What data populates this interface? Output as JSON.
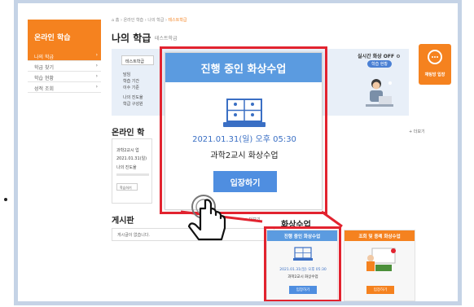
{
  "sidebar": {
    "title": "온라인 학습",
    "items": [
      {
        "label": "나의 학급",
        "active": true
      },
      {
        "label": "학급 찾기",
        "active": false
      },
      {
        "label": "학습 현황",
        "active": false
      },
      {
        "label": "성적 조회",
        "active": false
      }
    ]
  },
  "header": {
    "breadcrumb_home": "⌂ 홈",
    "breadcrumb_parts": [
      "온라인 학습",
      "나의 학급",
      "테스트학급"
    ],
    "title": "나의 학급",
    "subtitle": "테스트학급"
  },
  "info_panel": {
    "select_label": "테스트학급",
    "lines": [
      "담임",
      "학습 기간",
      "이수 기준",
      "나의 진도율",
      "학급 구성원"
    ],
    "realtime_label": "실시간 화상",
    "realtime_state": "OFF",
    "realtime_button": "학습 현황"
  },
  "help_button": {
    "label": "채팅방 입장",
    "icon": "chat-bubble-icon"
  },
  "online_learning": {
    "title": "온라인 학",
    "more": "+ 더보기",
    "card": {
      "lines": [
        "과학2교시 업",
        "2021.01.31(일)",
        "나의 진도율"
      ],
      "button": "학습하기"
    }
  },
  "board": {
    "title": "게시판",
    "more": "+ 더보기",
    "empty": "게시글이 없습니다."
  },
  "video_section": {
    "title": "화상수업",
    "cards": [
      {
        "header": "진행 중인 화상수업",
        "date": "2021.01.31(일) 오후 05:30",
        "name": "과학2교시 화상수업",
        "button": "입장하기",
        "color": "#5b9be0"
      },
      {
        "header": "조회 및 종례 화상수업",
        "date": "",
        "name": "",
        "button": "입장하기",
        "color": "#f5821f"
      }
    ]
  },
  "popup": {
    "header": "진행 중인 화상수업",
    "date": "2021.01.31(일) 오후 05:30",
    "name": "과학2교시 화상수업",
    "button": "입장하기",
    "icon": "video-conference-icon"
  },
  "colors": {
    "accent": "#f5821f",
    "blue": "#5b9be0",
    "highlight": "#e2232f"
  }
}
